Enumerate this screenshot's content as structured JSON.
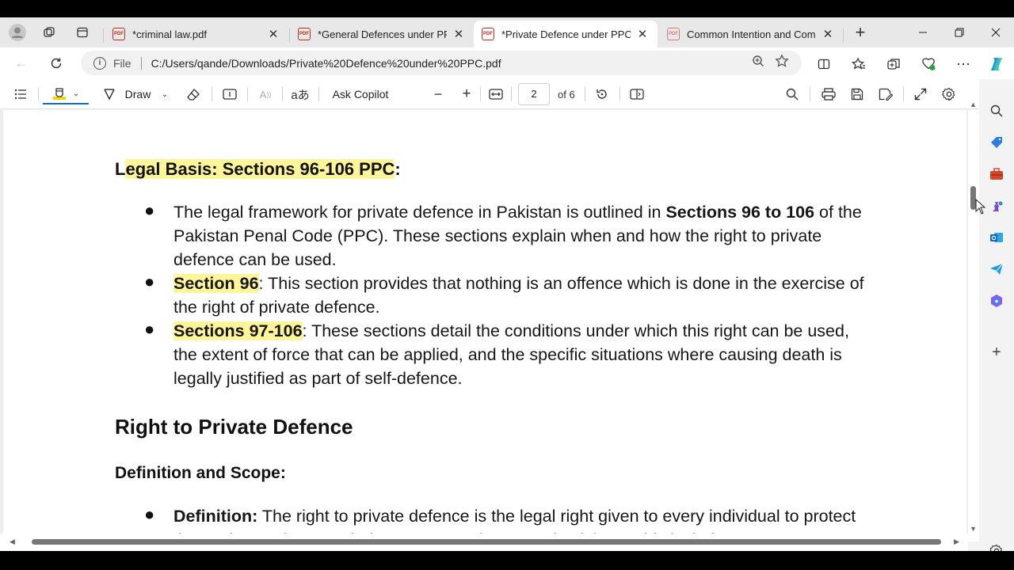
{
  "tabs": [
    {
      "label": "*criminal law.pdf",
      "active": false
    },
    {
      "label": "*General Defences under PPC.p",
      "active": false
    },
    {
      "label": "*Private Defence under PPC.pdf",
      "active": true
    },
    {
      "label": "Common Intention and Commo",
      "active": false
    }
  ],
  "address": {
    "scheme_label": "File",
    "url": "C:/Users/qande/Downloads/Private%20Defence%20under%20PPC.pdf"
  },
  "pdf_toolbar": {
    "draw_label": "Draw",
    "copilot_label": "Ask Copilot",
    "page_current": "2",
    "page_total": "of 6"
  },
  "doc": {
    "heading1_pre": "L",
    "heading1_hl": "egal Basis: Sections 96-106 PPC",
    "heading1_post": ":",
    "bullet1_a": "The legal framework for private defence in Pakistan is outlined in ",
    "bullet1_b": "Sections 96 to 106",
    "bullet1_c": " of the Pakistan Penal Code (PPC). These sections explain when and how the right to private defence can be used.",
    "bullet2_a": "Section 96",
    "bullet2_b": ": This section provides that nothing is an offence which is done in the exercise of the right of private defence.",
    "bullet3_a": "Sections 97-106",
    "bullet3_b": ": These sections detail the conditions under which this right can be used, the extent of force that can be applied, and the specific situations where causing death is legally justified as part of self-defence.",
    "heading2": "Right to Private Defence",
    "heading3": "Definition and Scope:",
    "bullet4_a": "Definition:",
    "bullet4_b": " The right to private defence is the legal right given to every individual to protect themselves, others, or their property against an unlawful act. This includes"
  },
  "colors": {
    "highlight": "#fff59a",
    "accent": "#0f6cbd",
    "pdf_red": "#c42b1c"
  }
}
